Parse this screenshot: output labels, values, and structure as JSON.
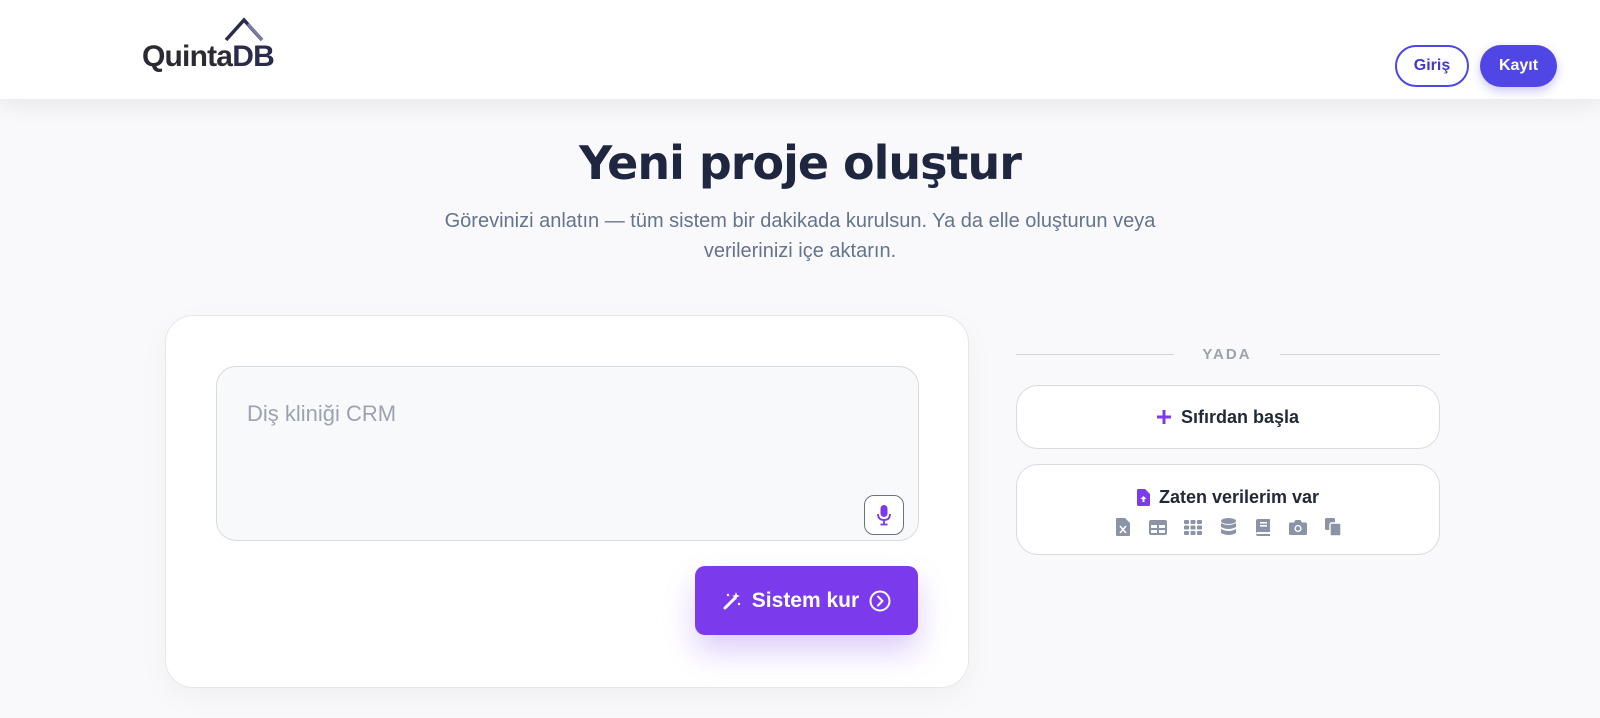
{
  "header": {
    "logo": {
      "part1": "Quinta",
      "part2": "DB"
    },
    "login_label": "Giriş",
    "register_label": "Kayıt"
  },
  "hero": {
    "title": "Yeni proje oluştur",
    "subtitle": "Görevinizi anlatın — tüm sistem bir dakikada kurulsun. Ya da elle oluşturun veya verilerinizi içe aktarın."
  },
  "prompt_card": {
    "placeholder": "Diş kliniği CRM",
    "value": "",
    "mic_icon": "microphone-icon",
    "submit_label": "Sistem kur",
    "submit_icon_left": "magic-wand-icon",
    "submit_icon_right": "chevron-right-circle-icon"
  },
  "options": {
    "or_label": "YADA",
    "start_scratch_label": "Sıfırdan başla",
    "have_data_label": "Zaten verilerim var",
    "data_formats": [
      "excel-icon",
      "table-icon",
      "grid-icon",
      "database-icon",
      "book-icon",
      "camera-icon",
      "copy-icon"
    ]
  },
  "colors": {
    "primary": "#4f46e5",
    "accent": "#7c3aed",
    "title": "#1e2640",
    "muted": "#64748b",
    "format_icons": "#8b93a7"
  }
}
